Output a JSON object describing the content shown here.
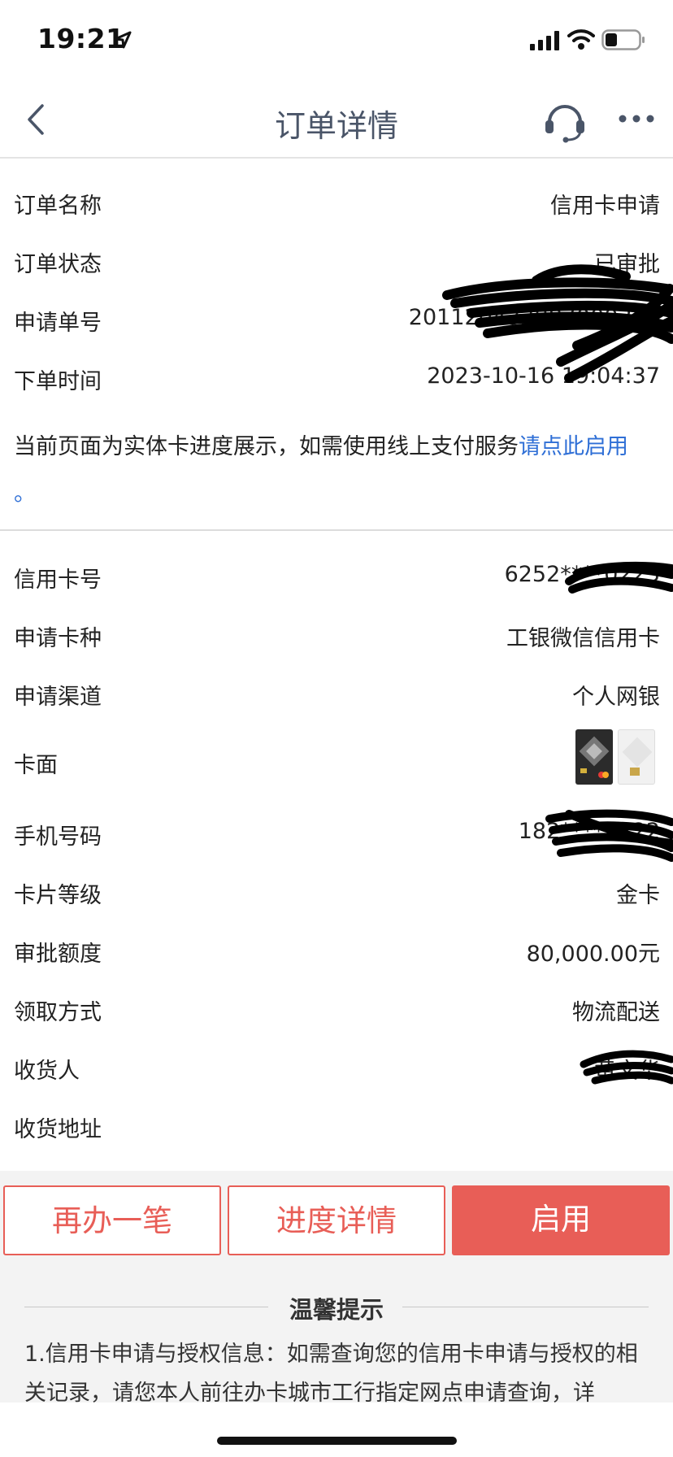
{
  "status_bar": {
    "time": "19:21"
  },
  "nav": {
    "title": "订单详情"
  },
  "order": {
    "rows": [
      {
        "label": "订单名称",
        "value": "信用卡申请"
      },
      {
        "label": "订单状态",
        "value": "已审批"
      },
      {
        "label": "申请单号",
        "value": "201120432887000344"
      },
      {
        "label": "下单时间",
        "value": "2023-10-16 19:04:37"
      }
    ],
    "notice_text": "当前页面为实体卡进度展示，如需使用线上支付服务",
    "notice_link": "请点此启用",
    "notice_end": "。"
  },
  "card": {
    "rows": [
      {
        "label": "信用卡号",
        "value": "6252****0223"
      },
      {
        "label": "申请卡种",
        "value": "工银微信信用卡"
      },
      {
        "label": "申请渠道",
        "value": "个人网银"
      },
      {
        "label": "卡面",
        "value": ""
      },
      {
        "label": "手机号码",
        "value": "182****2222"
      },
      {
        "label": "卡片等级",
        "value": "金卡"
      },
      {
        "label": "审批额度",
        "value": "80,000.00元"
      },
      {
        "label": "领取方式",
        "value": "物流配送"
      },
      {
        "label": "收货人",
        "value": "黄文华"
      },
      {
        "label": "收货地址",
        "value": ""
      }
    ]
  },
  "actions": {
    "again_label": "再办一笔",
    "progress_label": "进度详情",
    "activate_label": "启用"
  },
  "tips": {
    "title": "温馨提示",
    "text": "1.信用卡申请与授权信息：如需查询您的信用卡申请与授权的相关记录，请您本人前往办卡城市工行指定网点申请查询，详"
  },
  "colors": {
    "accent": "#e85e57",
    "link": "#2f6fd6",
    "title": "#4a5568"
  }
}
